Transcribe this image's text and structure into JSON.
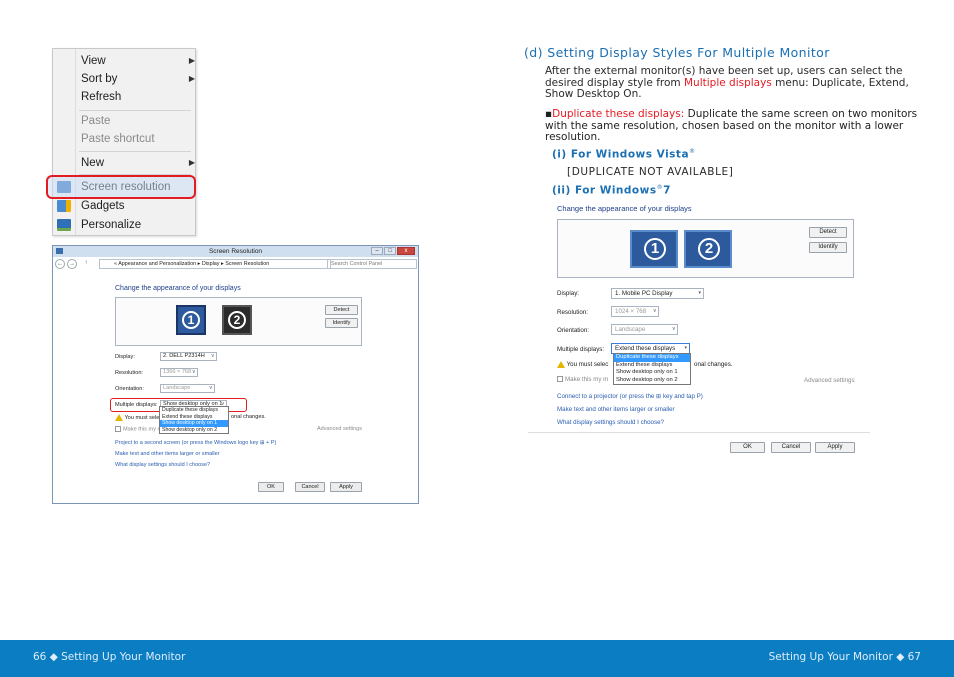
{
  "context_menu": {
    "items": [
      {
        "label": "View",
        "submenu": true,
        "disabled": false
      },
      {
        "label": "Sort by",
        "submenu": true,
        "disabled": false
      },
      {
        "label": "Refresh",
        "submenu": false,
        "disabled": false
      },
      {
        "label": "Paste",
        "submenu": false,
        "disabled": true
      },
      {
        "label": "Paste shortcut",
        "submenu": false,
        "disabled": true
      },
      {
        "label": "New",
        "submenu": true,
        "disabled": false
      },
      {
        "label": "Screen resolution",
        "submenu": false,
        "disabled": false,
        "highlighted": true
      },
      {
        "label": "Gadgets",
        "submenu": false,
        "disabled": false
      },
      {
        "label": "Personalize",
        "submenu": false,
        "disabled": false
      }
    ]
  },
  "win8_window": {
    "title": "Screen Resolution",
    "breadcrumb": "« Appearance and Personalization ▸ Display ▸ Screen Resolution",
    "search_placeholder": "Search Control Panel",
    "heading": "Change the appearance of your displays",
    "detect": "Detect",
    "identify": "Identify",
    "monitor_1": "1",
    "monitor_2": "2",
    "display_label": "Display:",
    "display_value": "2. DELL P2314H",
    "resolution_label": "Resolution:",
    "resolution_value": "1366 × 768",
    "orientation_label": "Orientation:",
    "orientation_value": "Landscape",
    "multiple_label": "Multiple displays:",
    "multiple_value": "Show desktop only on 1",
    "dropdown_options": [
      "Duplicate these displays",
      "Extend these displays",
      "Show desktop only on 1",
      "Show desktop only on 2"
    ],
    "warning_left": "You must select",
    "warning_right": "onal changes.",
    "make_main": "Make this my m",
    "advanced": "Advanced settings",
    "links": [
      "Project to a second screen (or press the Windows logo key ⊞ + P)",
      "Make text and other items larger or smaller",
      "What display settings should I choose?"
    ],
    "ok": "OK",
    "cancel": "Cancel",
    "apply": "Apply"
  },
  "section": {
    "title": "(d) Setting Display Styles For Multiple Monitor",
    "intro_before": "After the external monitor(s) have been set up, users can select the desired display style from ",
    "intro_highlight": "Multiple displays",
    "intro_after": " menu:  Duplicate, Extend, Show Desktop On.",
    "bullet_highlight": "Duplicate these displays:",
    "bullet_text": " Duplicate the same screen on two monitors with the same resolution, chosen based on the monitor with a lower resolution.",
    "vista_heading": "(i) For Windows Vista",
    "vista_note": "[DUPLICATE NOT AVAILABLE]",
    "win7_heading": "(ii) For Windows",
    "win7_suffix": "7",
    "reg_mark": "®"
  },
  "win7_dialog": {
    "heading": "Change the appearance of your displays",
    "detect": "Detect",
    "identify": "Identify",
    "monitor_1": "1",
    "monitor_2": "2",
    "display_label": "Display:",
    "display_value": "1. Mobile PC Display",
    "resolution_label": "Resolution:",
    "resolution_value": "1024 × 768",
    "orientation_label": "Orientation:",
    "orientation_value": "Landscape",
    "multiple_label": "Multiple displays:",
    "multiple_value": "Extend these displays",
    "dropdown_options": [
      "Duplicate these displays",
      "Extend these displays",
      "Show desktop only on 1",
      "Show desktop only on 2"
    ],
    "warning_left": "You must selec",
    "warning_right": "onal changes.",
    "make_main": "Make this my m",
    "advanced": "Advanced settings",
    "links": [
      "Connect to a projector (or press the ⊞ key and tap P)",
      "Make text and other items larger or smaller",
      "What display settings should I choose?"
    ],
    "ok": "OK",
    "cancel": "Cancel",
    "apply": "Apply"
  },
  "footer": {
    "left": "66  ◆  Setting Up Your Monitor",
    "right": "Setting Up Your Monitor  ◆  67"
  }
}
